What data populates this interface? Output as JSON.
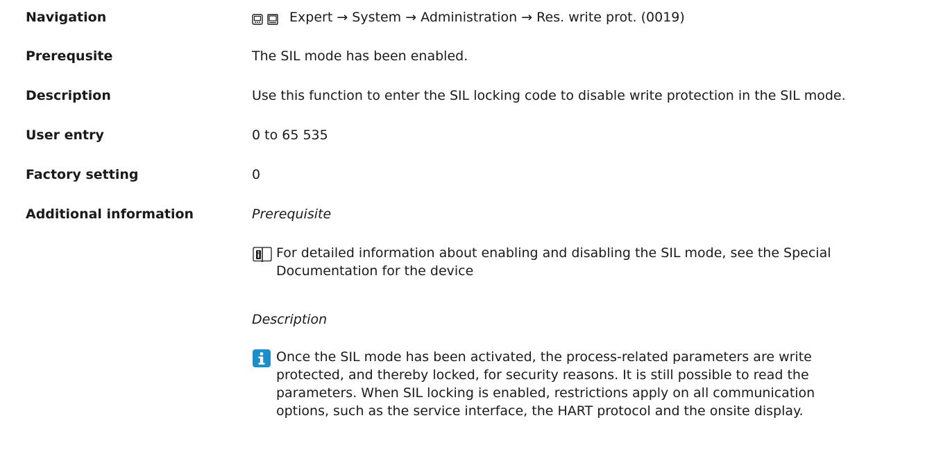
{
  "navigation": {
    "label": "Navigation",
    "icons": [
      "expert-display-icon",
      "expert-operating-tool-icon"
    ],
    "path": "Expert → System → Administration → Res. write prot. (0019)"
  },
  "prerequisite": {
    "label": "Prerequsite",
    "value": "The SIL mode has been enabled."
  },
  "description": {
    "label": "Description",
    "value": "Use this function to enter the SIL locking code to disable write protection in the SIL mode."
  },
  "user_entry": {
    "label": "User entry",
    "value": "0 to 65 535"
  },
  "factory_setting": {
    "label": "Factory setting",
    "value": "0"
  },
  "additional_information": {
    "label": "Additional information",
    "prerequisite_heading": "Prerequisite",
    "prerequisite_note": {
      "icon": "book-info-icon",
      "lines": [
        "For detailed information about enabling and disabling the SIL mode, see the Special",
        "Documentation for the device"
      ]
    },
    "description_heading": "Description",
    "description_note": {
      "icon": "info-icon",
      "color": "#1e8ec9",
      "lines": [
        "Once the SIL mode has been activated, the process-related parameters are write",
        "protected, and thereby locked, for security reasons. It is still possible to read the",
        "parameters. When SIL locking is enabled, restrictions apply on all communication",
        "options, such as the service interface, the HART protocol and the onsite display."
      ]
    }
  }
}
